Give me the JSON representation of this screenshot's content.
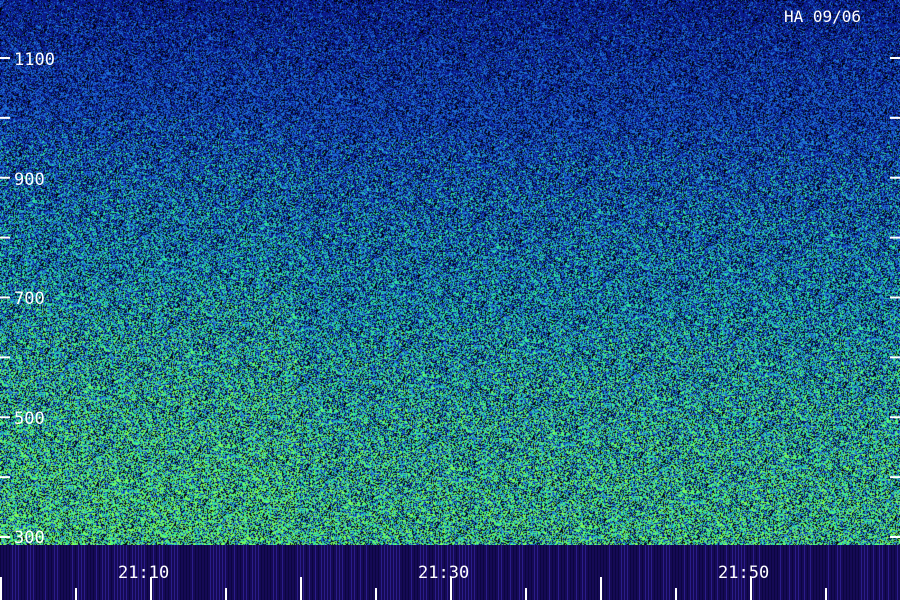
{
  "chart_data": {
    "type": "heatmap",
    "title": "HA 09/06",
    "xlabel": "",
    "ylabel": "",
    "x_tick_labels": [
      "21:10",
      "21:30",
      "21:50"
    ],
    "y_tick_labels": [
      "300",
      "500",
      "700",
      "900",
      "1100"
    ],
    "y_tick_values": [
      300,
      500,
      700,
      900,
      1100
    ],
    "ylim": [
      300,
      1100
    ],
    "grid": false,
    "legend": "none",
    "colors": {
      "background": "#000000",
      "low": "#0a1a8c",
      "mid": "#1e6fd6",
      "high": "#2ee6a0",
      "peak": "#7cff5a",
      "band": "#150a55",
      "text": "#ffffff"
    }
  }
}
